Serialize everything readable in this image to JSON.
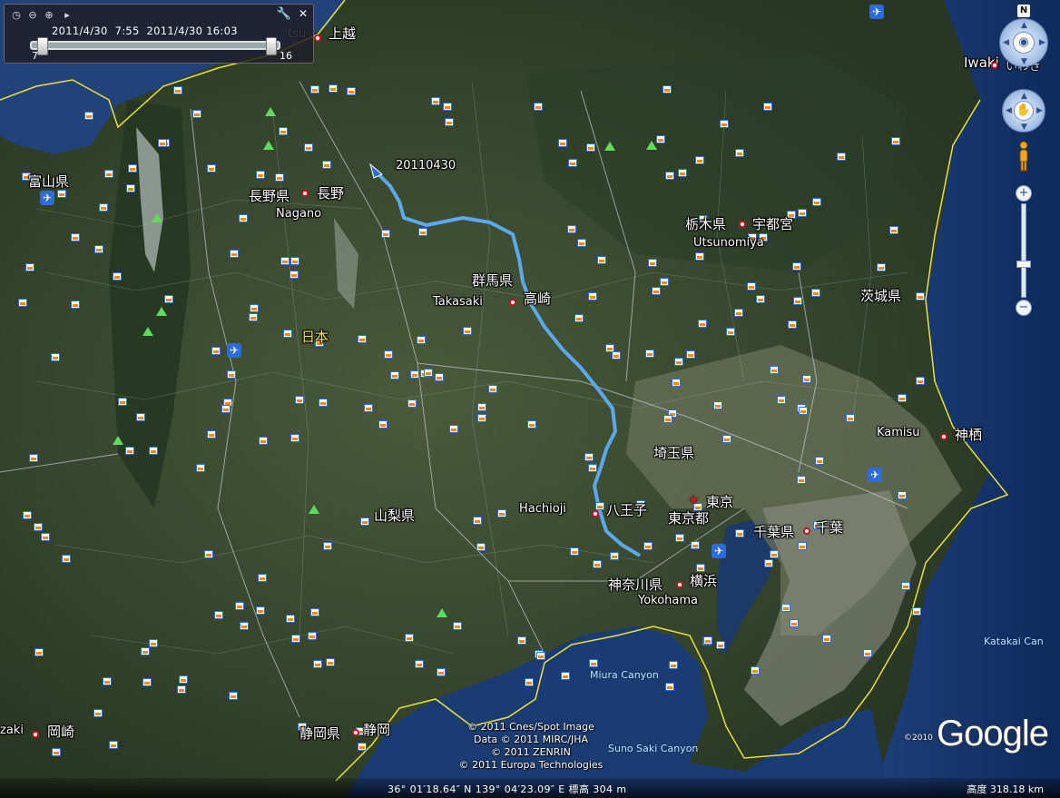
{
  "track": {
    "label": "20110430"
  },
  "time_slider": {
    "start": "2011/4/30",
    "start_time": "7:55",
    "end": "2011/4/30",
    "end_time": "16:03",
    "tick_left": "7",
    "tick_right": "16"
  },
  "places": {
    "joetsu": "上越",
    "nagano_ken": "長野県",
    "nagano_city": "長野",
    "nagano_en": "Nagano",
    "toyama_ken": "富山県",
    "tochigi_ken": "栃木県",
    "utsunomiya": "宇都宮",
    "utsunomiya_en": "Utsunomiya",
    "gunma_ken": "群馬県",
    "takasaki_en": "Takasaki",
    "takasaki": "高崎",
    "ibaraki_ken": "茨城県",
    "nihon": "日本",
    "saitama_ken": "埼玉県",
    "kamisu_en": "Kamisu",
    "kamisu": "神栖",
    "yamanashi_ken": "山梨県",
    "hachioji_en": "Hachioji",
    "hachioji": "八王子",
    "tokyo": "東京",
    "tokyo_to": "東京都",
    "chiba_ken": "千葉県",
    "chiba": "千葉",
    "kanagawa_ken": "神奈川県",
    "yokohama": "横浜",
    "yokohama_en": "Yokohama",
    "okazaki": "岡崎",
    "okazaki_partial": "zaki",
    "shizuoka_ken": "静岡県",
    "shizuoka": "静岡",
    "iwaki_en": "Iwaki",
    "iwaki_partial": "いわき",
    "katakai": "Katakai Can",
    "miura_canyon": "Miura Canyon",
    "sunosaki_canyon": "Suno Saki Canyon",
    "joetsu_en_partial": "tsu"
  },
  "credits": [
    "© 2011 Cnes/Spot Image",
    "Data © 2011 MIRC/JHA",
    "© 2011 ZENRIN",
    "© 2011 Europa Technologies"
  ],
  "google": {
    "logo": "Google",
    "year": "©2010"
  },
  "status": {
    "coords": "36° 01′18.64″ N 139° 04′23.09″ E 標高 304 m",
    "altitude": "高度  318.18 km"
  },
  "nav": {
    "north": "N",
    "zoom_in": "+",
    "zoom_out": "−"
  },
  "icons": {
    "time_slider": [
      "clock-icon",
      "zoom-out-time-icon",
      "zoom-in-time-icon",
      "play-icon",
      "wrench-icon",
      "close-icon"
    ],
    "nav": [
      "look-icon",
      "move-icon",
      "pegman-icon"
    ]
  }
}
